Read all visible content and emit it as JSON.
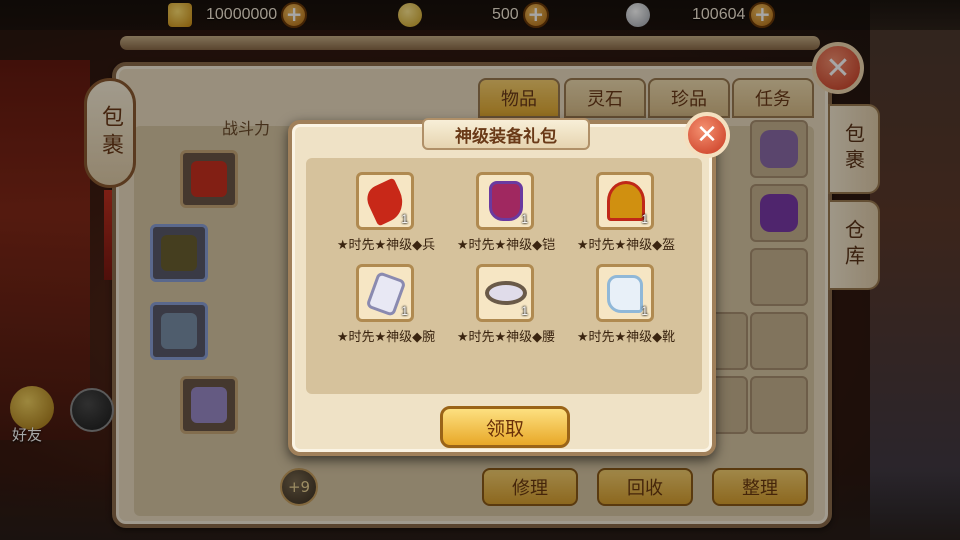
{
  "resources": {
    "gold": "10000000",
    "coins": "500",
    "silver": "100604"
  },
  "bag_panel": {
    "side_tab_label": "包裹",
    "combat_power_label": "战斗力",
    "tabs": [
      "物品",
      "灵石",
      "珍品",
      "任务"
    ],
    "right_tabs": [
      "包裹",
      "仓库"
    ],
    "enhance_badge": "+9",
    "buttons": {
      "repair": "修理",
      "recycle": "回收",
      "sort": "整理"
    }
  },
  "hud": {
    "friends_label": "好友"
  },
  "gift_dialog": {
    "title": "神级装备礼包",
    "items": [
      {
        "name": "★时先★神级◆兵",
        "qty": "1",
        "icon": "weapon-icon",
        "color": "#c82818"
      },
      {
        "name": "★时先★神级◆铠",
        "qty": "1",
        "icon": "armor-icon",
        "color": "#a02860"
      },
      {
        "name": "★时先★神级◆盔",
        "qty": "1",
        "icon": "helmet-icon",
        "color": "#d09010"
      },
      {
        "name": "★时先★神级◆腕",
        "qty": "1",
        "icon": "bracer-icon",
        "color": "#8a8ab0"
      },
      {
        "name": "★时先★神级◆腰",
        "qty": "1",
        "icon": "belt-icon",
        "color": "#b0a8c8"
      },
      {
        "name": "★时先★神级◆靴",
        "qty": "1",
        "icon": "boots-icon",
        "color": "#90b8d8"
      }
    ],
    "claim_label": "领取"
  }
}
